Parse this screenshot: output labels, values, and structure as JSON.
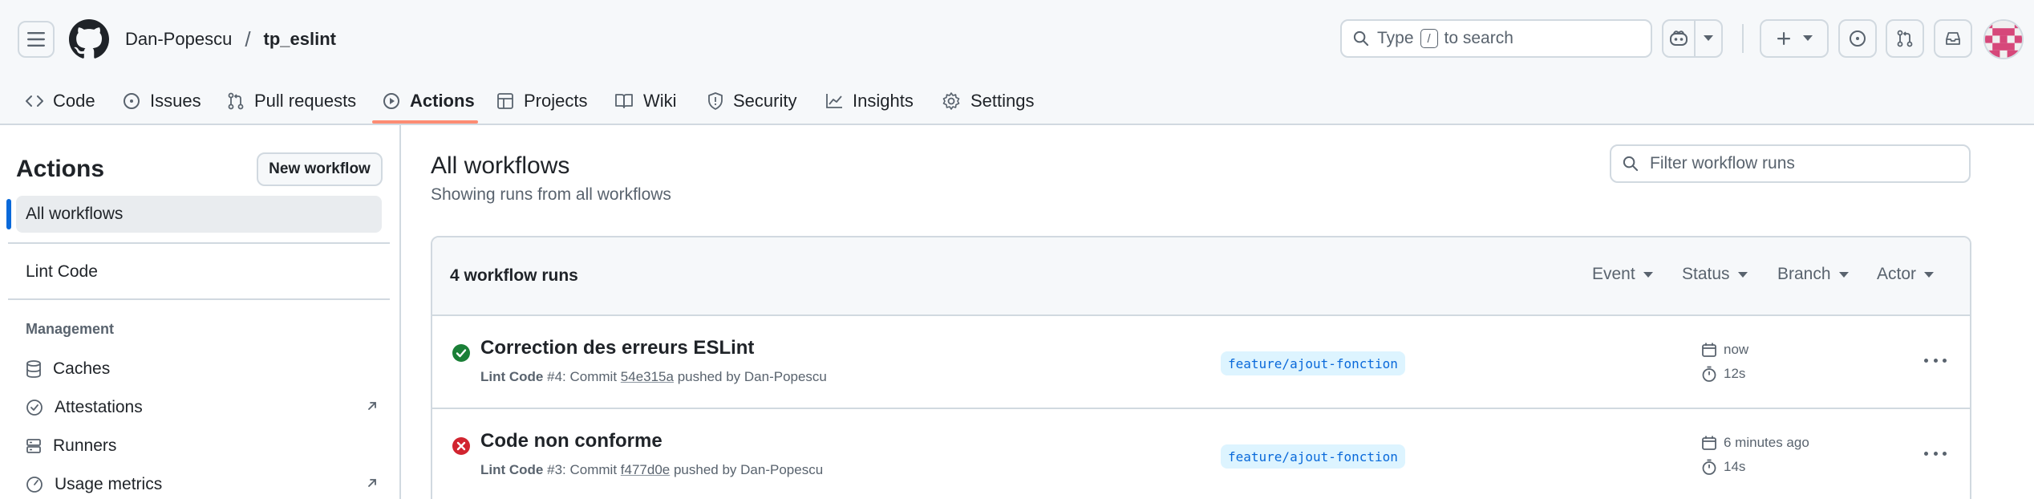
{
  "header": {
    "owner": "Dan-Popescu",
    "separator": "/",
    "repo": "tp_eslint",
    "search_prefix": "Type",
    "search_key": "/",
    "search_suffix": "to search"
  },
  "tabs": [
    {
      "label": "Code",
      "icon": "code-icon"
    },
    {
      "label": "Issues",
      "icon": "issue-opened-icon"
    },
    {
      "label": "Pull requests",
      "icon": "git-pull-request-icon"
    },
    {
      "label": "Actions",
      "icon": "play-icon",
      "active": true
    },
    {
      "label": "Projects",
      "icon": "table-icon"
    },
    {
      "label": "Wiki",
      "icon": "book-icon"
    },
    {
      "label": "Security",
      "icon": "shield-icon"
    },
    {
      "label": "Insights",
      "icon": "graph-icon"
    },
    {
      "label": "Settings",
      "icon": "gear-icon"
    }
  ],
  "sidebar": {
    "title": "Actions",
    "new_workflow": "New workflow",
    "all_workflows": "All workflows",
    "workflows": [
      "Lint Code"
    ],
    "management_label": "Management",
    "management": [
      {
        "label": "Caches",
        "icon": "database-icon",
        "external": false
      },
      {
        "label": "Attestations",
        "icon": "verified-icon",
        "external": true
      },
      {
        "label": "Runners",
        "icon": "server-icon",
        "external": false
      },
      {
        "label": "Usage metrics",
        "icon": "meter-icon",
        "external": true
      }
    ]
  },
  "main": {
    "title": "All workflows",
    "subtitle": "Showing runs from all workflows",
    "filter_placeholder": "Filter workflow runs",
    "runs_count": "4 workflow runs",
    "filters": [
      "Event",
      "Status",
      "Branch",
      "Actor"
    ],
    "runs": [
      {
        "status": "success",
        "title": "Correction des erreurs ESLint",
        "workflow": "Lint Code",
        "number": "#4",
        "commit_text": ": Commit",
        "sha": "54e315a",
        "pushed_by": "pushed by Dan-Popescu",
        "branch": "feature/ajout-fonction",
        "time": "now",
        "duration": "12s"
      },
      {
        "status": "failure",
        "title": "Code non conforme",
        "workflow": "Lint Code",
        "number": "#3",
        "commit_text": ": Commit",
        "sha": "f477d0e",
        "pushed_by": "pushed by Dan-Popescu",
        "branch": "feature/ajout-fonction",
        "time": "6 minutes ago",
        "duration": "14s"
      }
    ]
  },
  "colors": {
    "accent": "#0969da",
    "success": "#1a7f37",
    "failure": "#d1242f",
    "tab_underline": "#fd8c73",
    "branch_bg": "#ddf4ff"
  }
}
